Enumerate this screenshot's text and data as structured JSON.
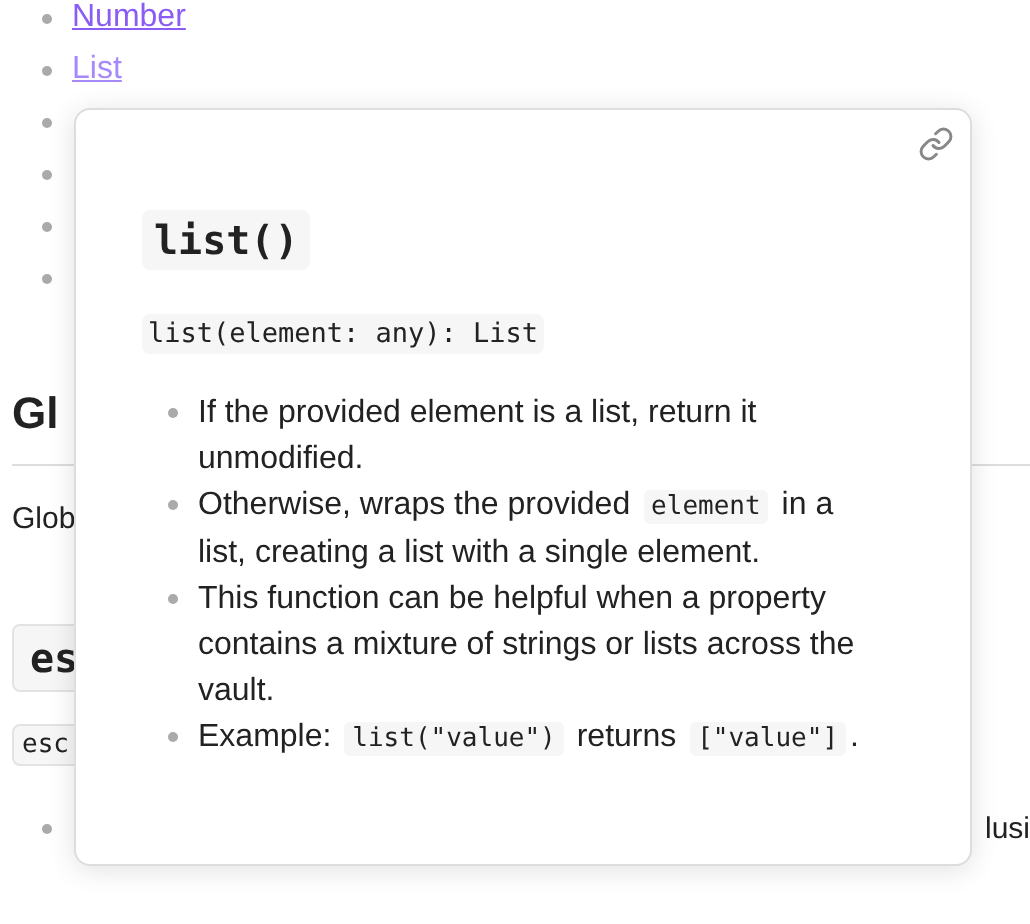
{
  "page": {
    "links": [
      {
        "text": "Number",
        "visited": false
      },
      {
        "text": "List",
        "visited": true
      }
    ],
    "heading": "Gl",
    "paragraph": "Glob",
    "code_heading": "es",
    "code_signature": "esc",
    "list_tail": "lusi"
  },
  "popover": {
    "title": "list()",
    "signature": "list(element: any): List",
    "items": [
      [
        {
          "kind": "text",
          "text": "If the provided element is a list, return it unmodified."
        }
      ],
      [
        {
          "kind": "text",
          "text": "Otherwise, wraps the provided "
        },
        {
          "kind": "code",
          "text": "element"
        },
        {
          "kind": "text",
          "text": " in a list, creating a list with a single element."
        }
      ],
      [
        {
          "kind": "text",
          "text": "This function can be helpful when a property contains a mixture of strings or lists across the vault."
        }
      ],
      [
        {
          "kind": "text",
          "text": "Example: "
        },
        {
          "kind": "code",
          "text": "list(\"value\")"
        },
        {
          "kind": "text",
          "text": " returns "
        },
        {
          "kind": "code",
          "text": "[\"value\"]"
        },
        {
          "kind": "text",
          "text": "."
        }
      ]
    ]
  }
}
